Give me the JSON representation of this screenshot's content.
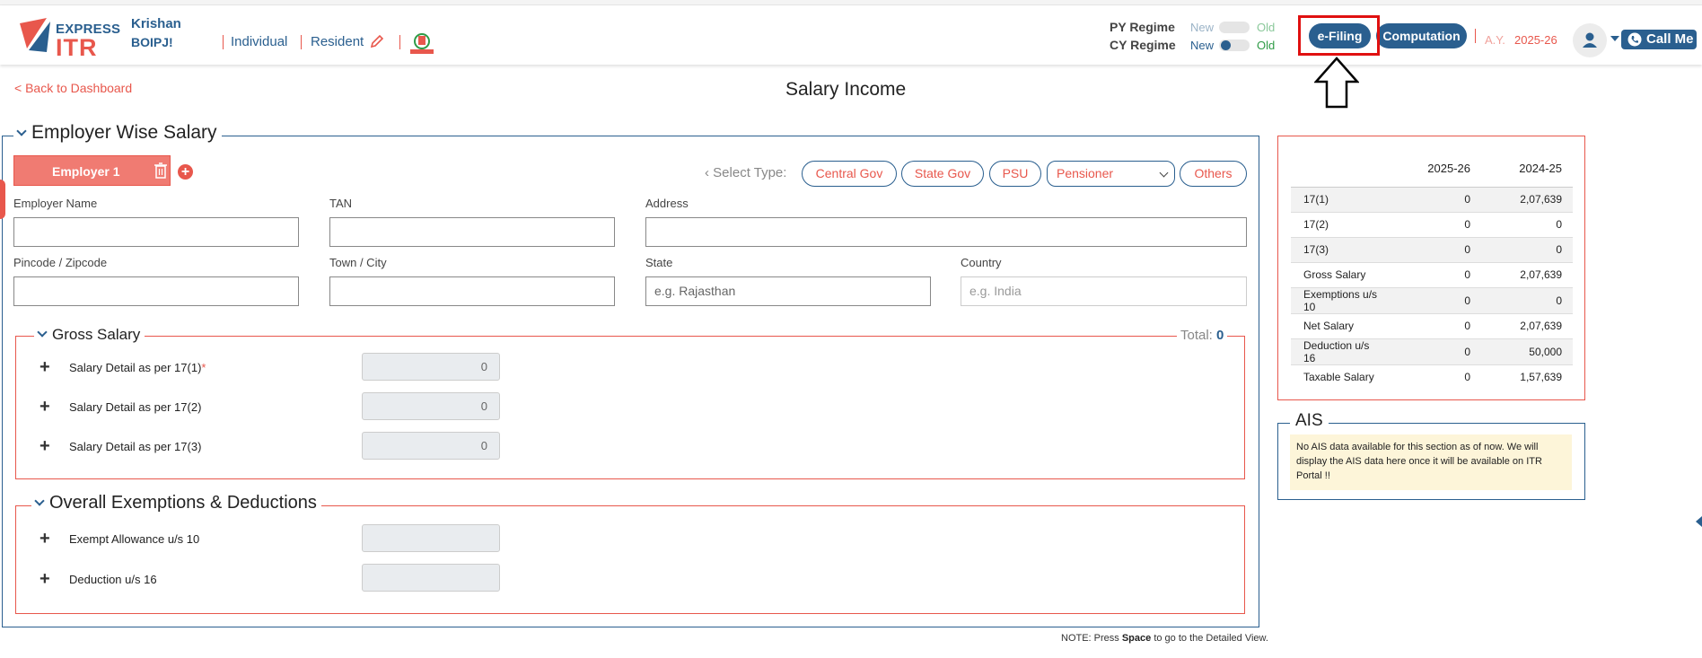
{
  "header": {
    "logo_top": "EXPRESS",
    "logo_bottom": "ITR",
    "user_name": "Krishan",
    "user_pan": "BOIPJ!",
    "status_individual": "Individual",
    "status_resident": "Resident",
    "py_regime": "PY Regime",
    "cy_regime": "CY Regime",
    "new_label": "New",
    "old_label": "Old",
    "efiling": "e-Filing",
    "computation": "Computation",
    "ay_label": "A.Y.",
    "ay_value": "2025-26",
    "call_me": "Call Me"
  },
  "page": {
    "back": "< Back to Dashboard",
    "title": "Salary Income",
    "note_prefix": "NOTE: Press ",
    "note_key": "Space",
    "note_suffix": " to go to the Detailed View."
  },
  "employer": {
    "section_title": "Employer Wise Salary",
    "tab_label": "Employer 1",
    "add_symbol": "+",
    "select_type": "Select Type:",
    "types": [
      "Central Gov",
      "State Gov",
      "PSU",
      "Others"
    ],
    "pensioner": "Pensioner",
    "fields": {
      "employer_name": "Employer Name",
      "tan": "TAN",
      "address": "Address",
      "pincode": "Pincode / Zipcode",
      "town": "Town / City",
      "state": "State",
      "state_placeholder": "e.g. Rajasthan",
      "country": "Country",
      "country_placeholder": "e.g. India"
    }
  },
  "gross": {
    "title": "Gross Salary",
    "total_label": "Total:",
    "total_value": "0",
    "rows": [
      {
        "label": "Salary Detail as per 17(1)",
        "required": "*",
        "value": "0"
      },
      {
        "label": "Salary Detail as per 17(2)",
        "value": "0"
      },
      {
        "label": "Salary Detail as per 17(3)",
        "value": "0"
      }
    ]
  },
  "exemptions": {
    "title": "Overall Exemptions & Deductions",
    "rows": [
      {
        "label": "Exempt Allowance u/s 10"
      },
      {
        "label": "Deduction u/s 16"
      }
    ]
  },
  "summary": {
    "col1": "2025-26",
    "col2": "2024-25",
    "rows": [
      {
        "label": "17(1)",
        "a": "0",
        "b": "2,07,639"
      },
      {
        "label": "17(2)",
        "a": "0",
        "b": "0"
      },
      {
        "label": "17(3)",
        "a": "0",
        "b": "0"
      },
      {
        "label": "Gross Salary",
        "a": "0",
        "b": "2,07,639"
      },
      {
        "label": "Exemptions u/s 10",
        "a": "0",
        "b": "0"
      },
      {
        "label": "Net Salary",
        "a": "0",
        "b": "2,07,639"
      },
      {
        "label": "Deduction u/s 16",
        "a": "0",
        "b": "50,000"
      },
      {
        "label": "Taxable Salary",
        "a": "0",
        "b": "1,57,639"
      }
    ]
  },
  "ais": {
    "title": "AIS",
    "message": "No AIS data available for this section as of now. We will display the AIS data here once it will be available on ITR Portal !!"
  },
  "colors": {
    "brand_blue": "#2a5f8f",
    "brand_red": "#e8574c",
    "highlight_red": "#e01010",
    "old_green": "#2e9b46"
  }
}
